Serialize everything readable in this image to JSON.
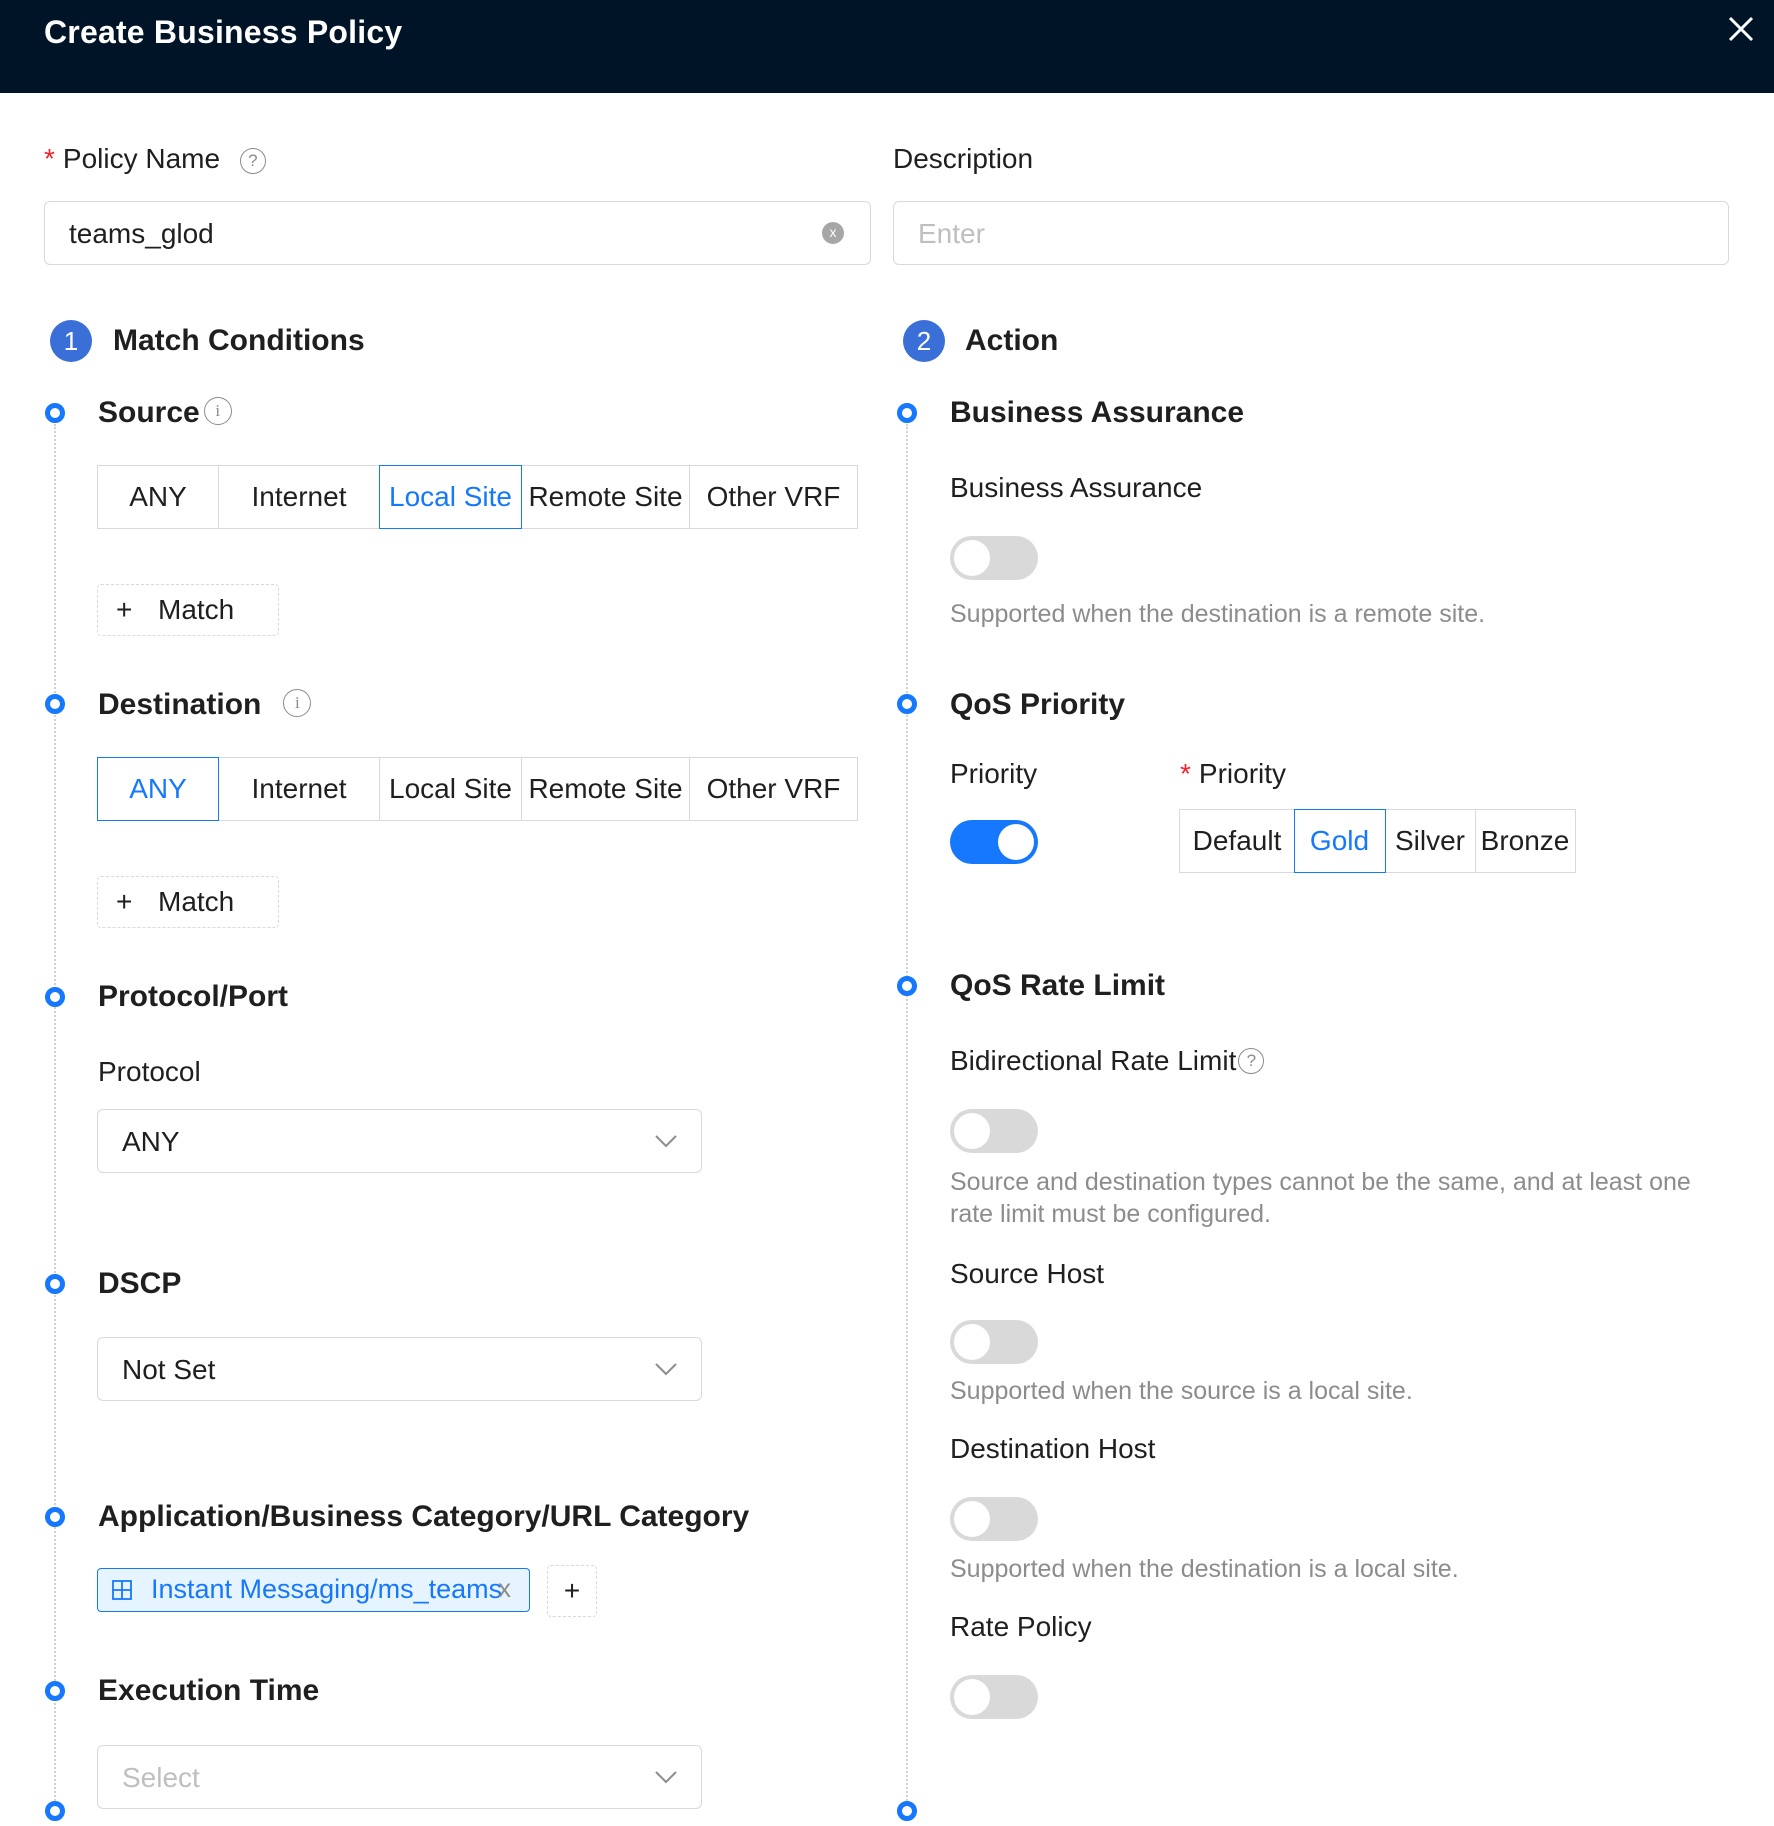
{
  "header": {
    "title": "Create Business Policy"
  },
  "policy_name": {
    "required_mark": "*",
    "label": "Policy Name",
    "help": "?",
    "value": "teams_glod",
    "clear_glyph": "x"
  },
  "description": {
    "label": "Description",
    "placeholder": "Enter"
  },
  "steps": {
    "match": {
      "number": "1",
      "title": "Match Conditions"
    },
    "action": {
      "number": "2",
      "title": "Action"
    }
  },
  "source": {
    "title": "Source",
    "info": "i",
    "options": [
      "ANY",
      "Internet",
      "Local Site",
      "Remote Site",
      "Other VRF"
    ],
    "selected": "Local Site",
    "match_plus": "+",
    "match_label": "Match"
  },
  "destination": {
    "title": "Destination",
    "info": "i",
    "options": [
      "ANY",
      "Internet",
      "Local Site",
      "Remote Site",
      "Other VRF"
    ],
    "selected": "ANY",
    "match_plus": "+",
    "match_label": "Match"
  },
  "protocol_port": {
    "title": "Protocol/Port",
    "protocol_label": "Protocol",
    "protocol_value": "ANY"
  },
  "dscp": {
    "title": "DSCP",
    "value": "Not Set"
  },
  "application": {
    "title": "Application/Business Category/URL Category",
    "tag": "Instant Messaging/ms_teams",
    "tag_close": "x",
    "add": "+"
  },
  "execution_time": {
    "title": "Execution Time",
    "placeholder": "Select"
  },
  "business_assurance": {
    "title": "Business Assurance",
    "label": "Business Assurance",
    "enabled": false,
    "hint": "Supported when the destination is a remote site."
  },
  "qos_priority": {
    "title": "QoS Priority",
    "priority_label": "Priority",
    "enabled": true,
    "required_mark": "*",
    "level_label": "Priority",
    "levels": [
      "Default",
      "Gold",
      "Silver",
      "Bronze"
    ],
    "selected": "Gold"
  },
  "qos_rate_limit": {
    "title": "QoS Rate Limit",
    "bidirectional_label": "Bidirectional Rate Limit",
    "bidirectional_help": "?",
    "bidirectional_enabled": false,
    "bidirectional_hint_line1": "Source and destination types cannot be the same, and at least one",
    "bidirectional_hint_line2": "rate limit must be configured.",
    "source_host_label": "Source Host",
    "source_host_enabled": false,
    "source_host_hint": "Supported when the source is a local site.",
    "destination_host_label": "Destination Host",
    "destination_host_enabled": false,
    "destination_host_hint": "Supported when the destination is a local site.",
    "rate_policy_label": "Rate Policy",
    "rate_policy_enabled": false
  },
  "icons": {
    "close": "close-icon",
    "help": "help-circle-icon",
    "info": "info-circle-icon",
    "chevron": "chevron-down-icon",
    "app": "grid-icon"
  },
  "colors": {
    "header_bg": "#001428",
    "accent": "#1677ff",
    "step_badge": "#3a6fd8",
    "required": "#f5222d"
  }
}
